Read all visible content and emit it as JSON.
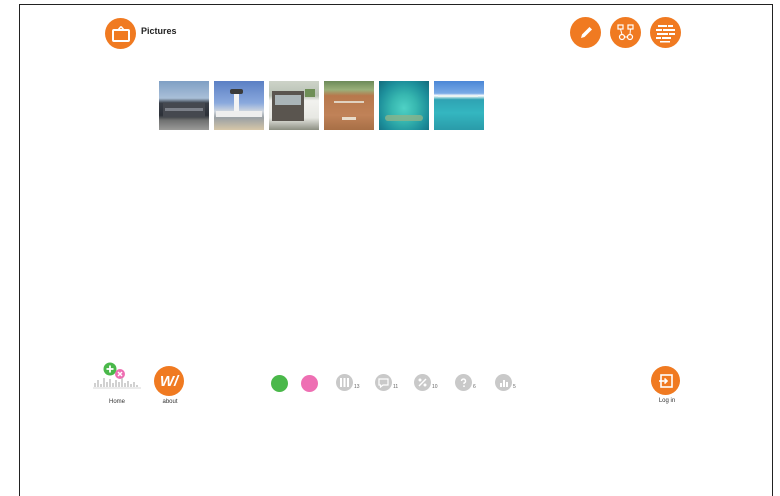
{
  "header": {
    "title": "Pictures",
    "title_icon": "picture-frame-icon",
    "actions": [
      {
        "name": "edit-button",
        "icon": "pencil-icon"
      },
      {
        "name": "network-button",
        "icon": "network-icon"
      },
      {
        "name": "wordcloud-button",
        "icon": "word-cloud-icon"
      }
    ]
  },
  "gallery": {
    "thumbnails": [
      {
        "name": "thumb-building"
      },
      {
        "name": "thumb-airport-tower"
      },
      {
        "name": "thumb-bus-station"
      },
      {
        "name": "thumb-baseball-field"
      },
      {
        "name": "thumb-coral-reef"
      },
      {
        "name": "thumb-ocean-shore"
      }
    ]
  },
  "footer": {
    "home_label": "Home",
    "about_label": "about",
    "about_glyph": "W/",
    "login_label": "Log in",
    "stats": [
      {
        "name": "stat-columns",
        "icon": "columns-icon",
        "count": "13"
      },
      {
        "name": "stat-comments",
        "icon": "speech-bubble-icon",
        "count": "11"
      },
      {
        "name": "stat-links",
        "icon": "link-icon",
        "count": "10"
      },
      {
        "name": "stat-questions",
        "icon": "question-icon",
        "count": "6"
      },
      {
        "name": "stat-reactions",
        "icon": "chart-icon",
        "count": "5"
      }
    ]
  },
  "colors": {
    "accent": "#f07a21",
    "green": "#4ab84a",
    "pink": "#ee6fb3",
    "gray": "#c9c9c9"
  }
}
